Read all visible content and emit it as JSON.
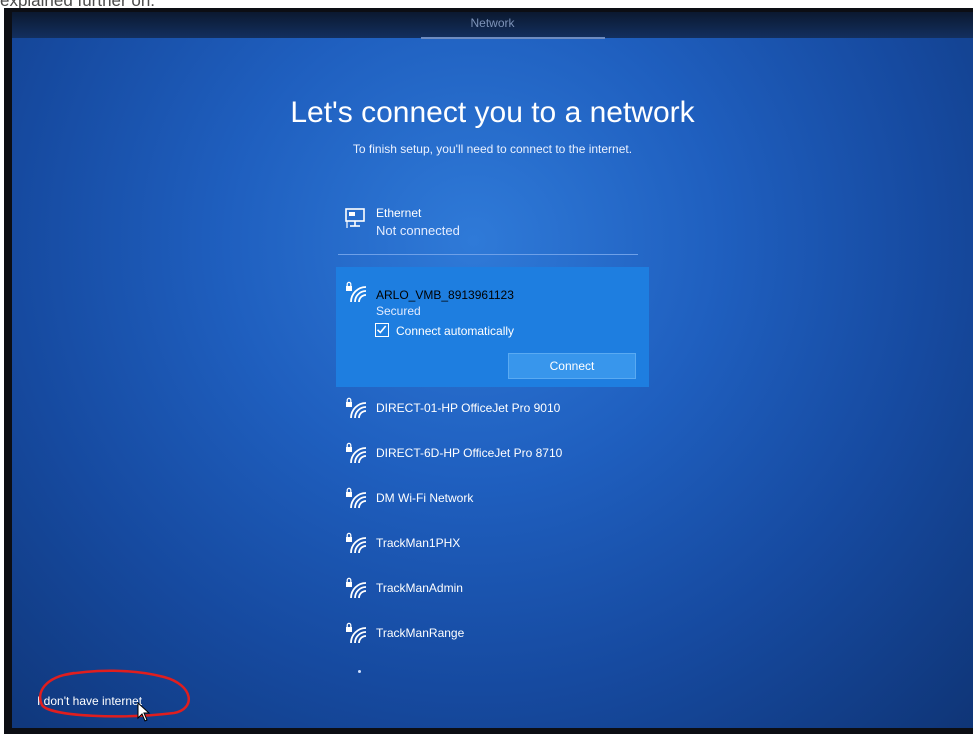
{
  "caption": "explained further on.",
  "window": {
    "title": "Network"
  },
  "main": {
    "heading": "Let's connect you to a network",
    "subheading": "To finish setup, you'll need to connect to the internet."
  },
  "ethernet": {
    "name": "Ethernet",
    "status": "Not connected",
    "icon": "ethernet-icon"
  },
  "selected_network": {
    "name": "ARLO_VMB_8913961123",
    "status": "Secured",
    "auto_connect_label": "Connect automatically",
    "auto_connect_checked": true,
    "connect_button": "Connect",
    "icon": "wifi-secured-icon"
  },
  "networks": [
    {
      "name": "DIRECT-01-HP OfficeJet Pro 9010",
      "icon": "wifi-secured-icon"
    },
    {
      "name": "DIRECT-6D-HP OfficeJet Pro 8710",
      "icon": "wifi-secured-icon"
    },
    {
      "name": "DM Wi-Fi Network",
      "icon": "wifi-secured-icon"
    },
    {
      "name": "TrackMan1PHX",
      "icon": "wifi-secured-icon"
    },
    {
      "name": "TrackManAdmin",
      "icon": "wifi-secured-icon"
    },
    {
      "name": "TrackManRange",
      "icon": "wifi-secured-icon"
    }
  ],
  "footer": {
    "no_internet_link": "I don't have internet"
  },
  "colors": {
    "background": "#1f5fbf",
    "selected": "#1e7ee0",
    "button": "#3896ec",
    "annotation": "#e01e1e"
  }
}
